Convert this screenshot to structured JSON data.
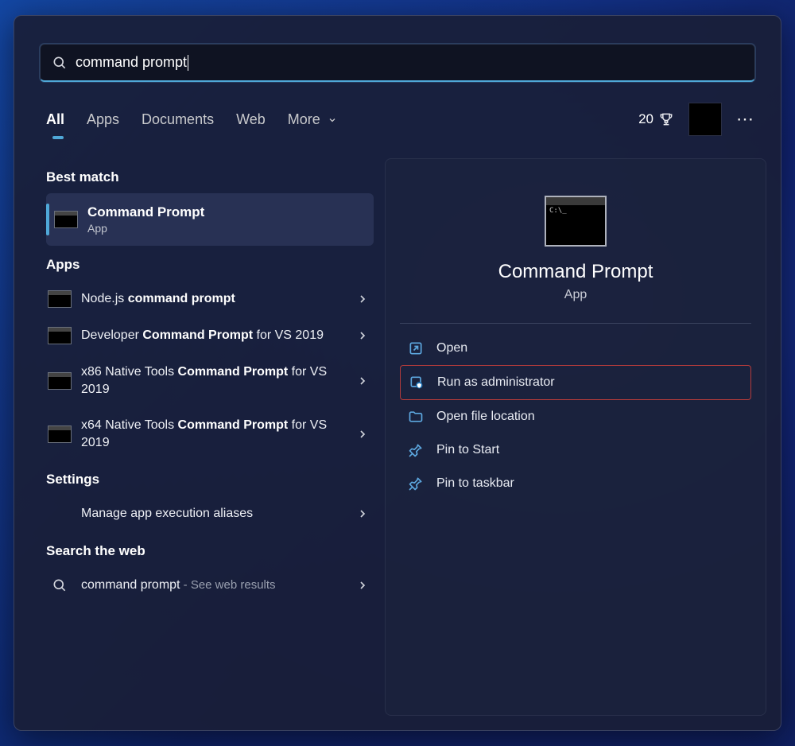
{
  "search": {
    "query": "command prompt"
  },
  "tabs": {
    "all": "All",
    "apps": "Apps",
    "documents": "Documents",
    "web": "Web",
    "more": "More"
  },
  "header": {
    "points": "20"
  },
  "sections": {
    "best_match": "Best match",
    "apps": "Apps",
    "settings": "Settings",
    "search_web": "Search the web"
  },
  "best_match": {
    "title": "Command Prompt",
    "subtitle": "App"
  },
  "apps_list": [
    {
      "pre": "Node.js ",
      "bold": "command prompt",
      "post": ""
    },
    {
      "pre": "Developer ",
      "bold": "Command Prompt",
      "post": " for VS 2019"
    },
    {
      "pre": "x86 Native Tools ",
      "bold": "Command Prompt",
      "post": " for VS 2019"
    },
    {
      "pre": "x64 Native Tools ",
      "bold": "Command Prompt",
      "post": " for VS 2019"
    }
  ],
  "settings_list": [
    {
      "label": "Manage app execution aliases"
    }
  ],
  "web_search": {
    "query": "command prompt",
    "suffix": " - See web results"
  },
  "detail": {
    "title": "Command Prompt",
    "subtitle": "App"
  },
  "actions": {
    "open": "Open",
    "run_admin": "Run as administrator",
    "open_location": "Open file location",
    "pin_start": "Pin to Start",
    "pin_taskbar": "Pin to taskbar"
  }
}
